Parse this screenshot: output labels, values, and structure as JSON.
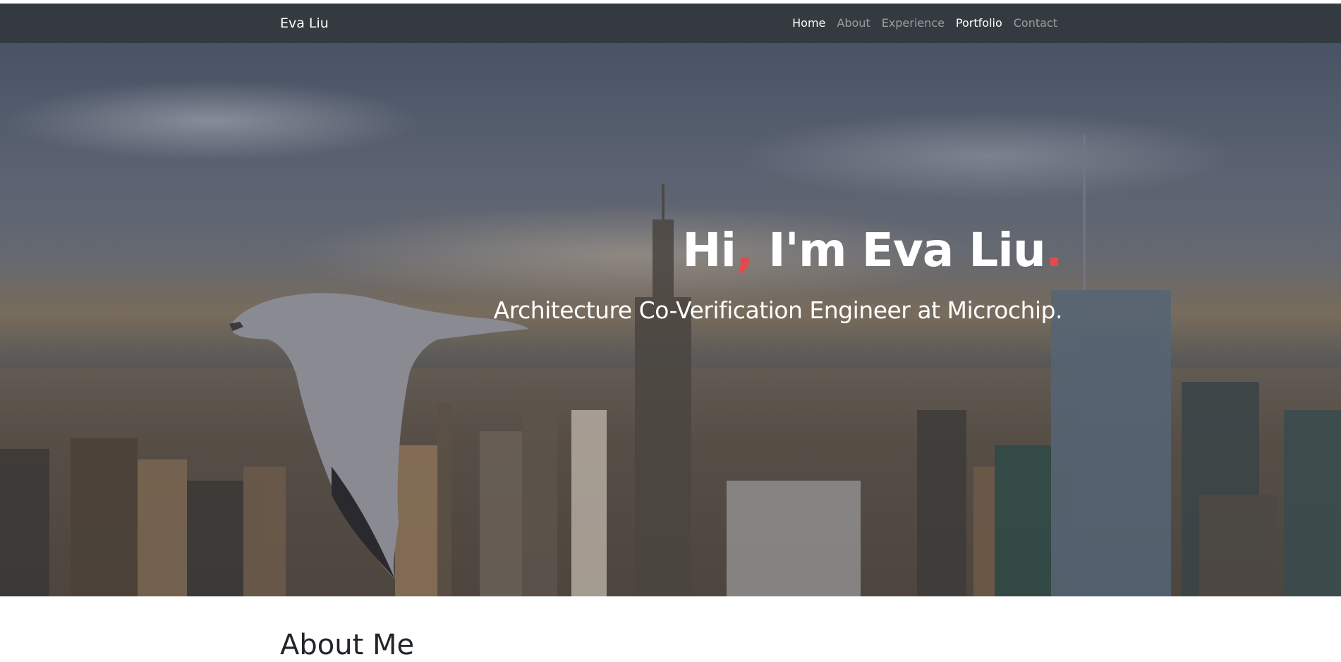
{
  "navbar": {
    "brand": "Eva Liu",
    "items": [
      {
        "label": "Home",
        "active": true
      },
      {
        "label": "About",
        "active": false
      },
      {
        "label": "Experience",
        "active": false
      },
      {
        "label": "Portfolio",
        "active": true
      },
      {
        "label": "Contact",
        "active": false
      }
    ]
  },
  "hero": {
    "title_part1": "Hi",
    "title_comma": ",",
    "title_part2": " I'm Eva Liu",
    "title_dot": ".",
    "subtitle": "Architecture Co-Verification Engineer at Microchip.",
    "background_image": "city-skyline-with-seagull"
  },
  "about": {
    "title": "About Me"
  },
  "colors": {
    "navbar_bg": "#343a40",
    "accent": "#e5484d",
    "nav_inactive": "rgba(255,255,255,0.5)",
    "text_dark": "#212529"
  }
}
